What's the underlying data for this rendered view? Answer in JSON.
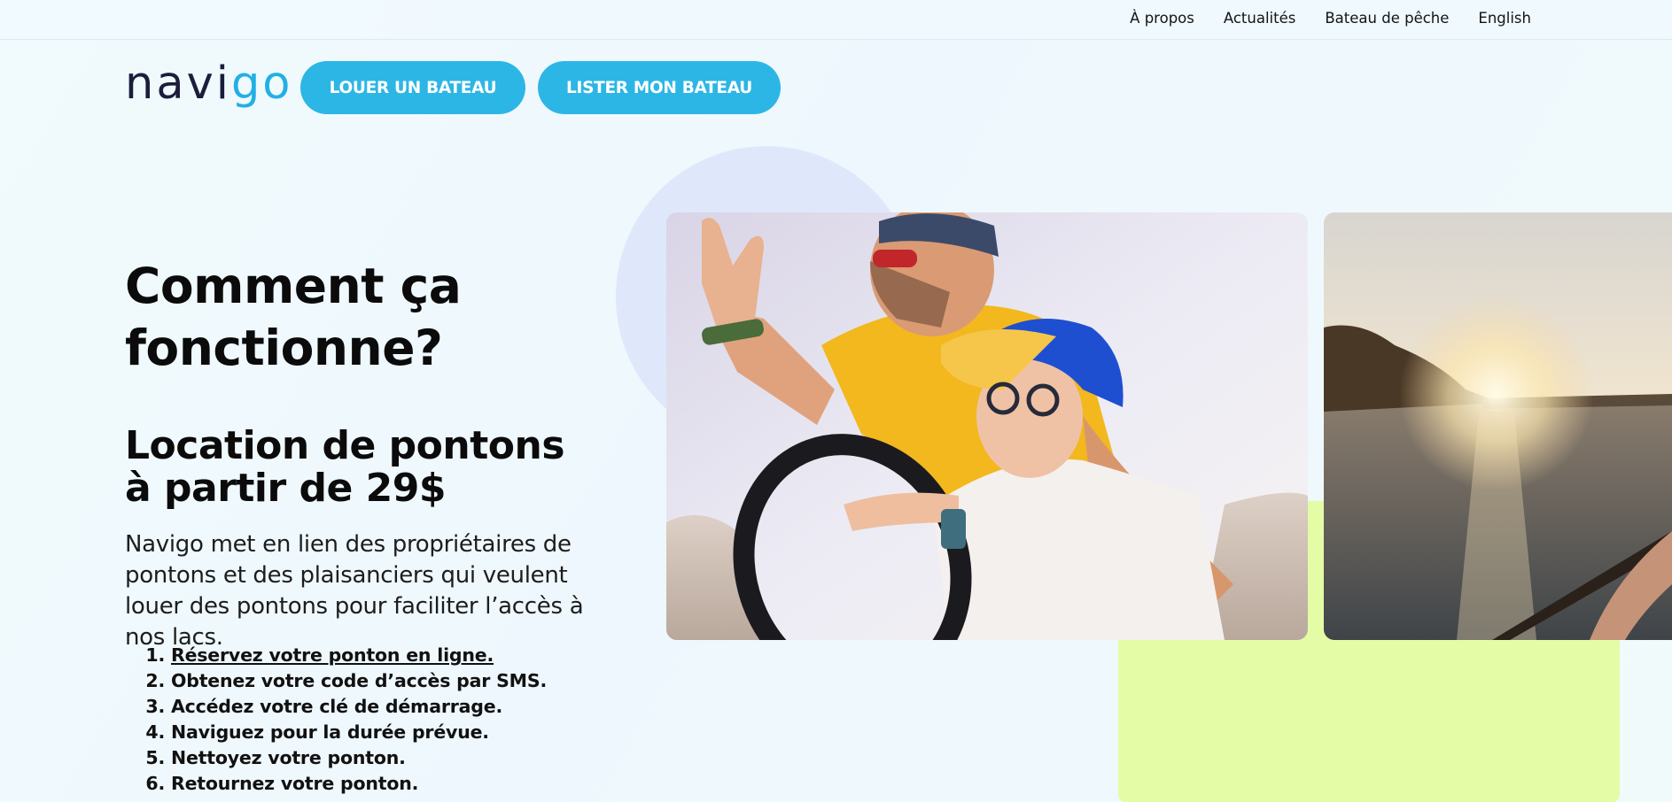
{
  "topnav": {
    "items": [
      {
        "label": "À propos"
      },
      {
        "label": "Actualités"
      },
      {
        "label": "Bateau de pêche"
      },
      {
        "label": "English"
      }
    ]
  },
  "header": {
    "logo": {
      "part1": "navi",
      "part2": "go"
    },
    "rent_button": "LOUER UN BATEAU",
    "list_button": "LISTER MON BATEAU"
  },
  "hero": {
    "title": "Comment ça fonctionne?",
    "subtitle_line1": "Location de pontons",
    "subtitle_line2": "à partir de 29$",
    "intro": "Navigo met en lien des propriétaires de pontons et des plaisanciers qui veulent louer des pontons pour faciliter l’accès à nos lacs.",
    "steps": [
      "Réservez votre ponton en ligne.",
      "Obtenez votre code d’accès par SMS.",
      "Accédez votre clé de démarrage.",
      "Naviguez pour la durée prévue.",
      "Nettoyez votre ponton.",
      "Retournez votre ponton."
    ]
  },
  "colors": {
    "brand_blue": "#2cb6e6",
    "logo_dark": "#1c1d3c",
    "lime_accent": "#e4fca6",
    "circle_accent": "#dfe8fb"
  }
}
